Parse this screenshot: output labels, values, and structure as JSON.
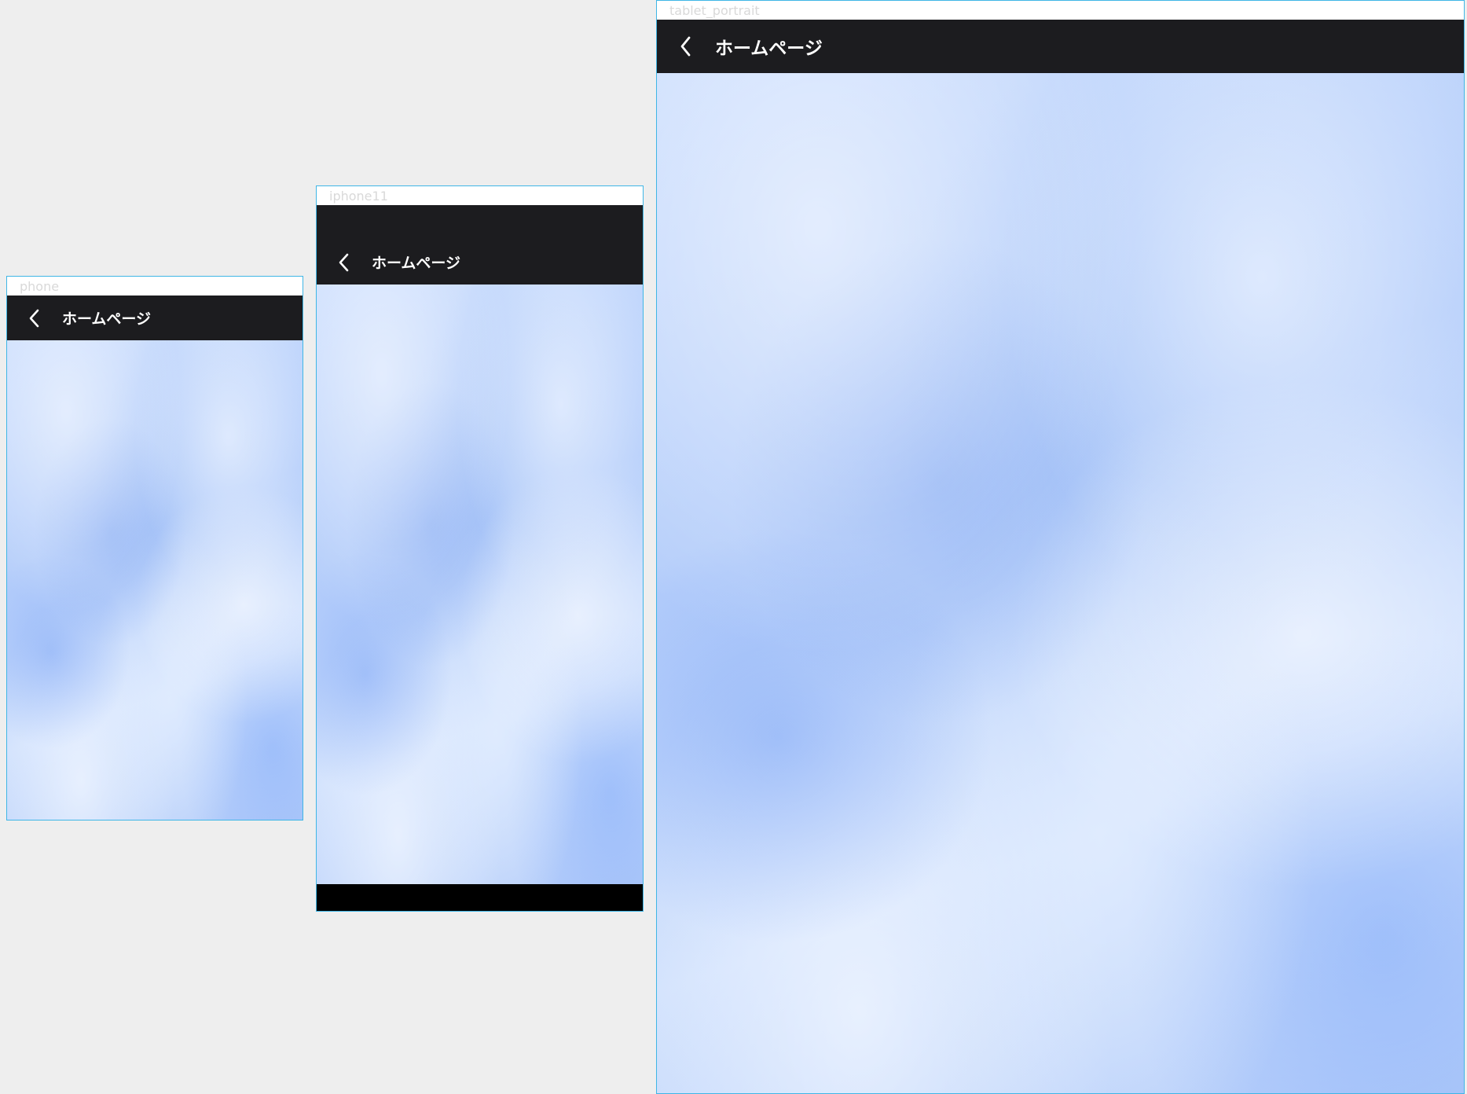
{
  "frames": {
    "phone": {
      "label": "phone",
      "appbar": {
        "back_icon": "chevron-left-icon",
        "title": "ホームページ"
      }
    },
    "iphone11": {
      "label": "iphone11",
      "appbar": {
        "back_icon": "chevron-left-icon",
        "title": "ホームページ"
      }
    },
    "tablet": {
      "label": "tablet_portrait",
      "appbar": {
        "back_icon": "chevron-left-icon",
        "title": "ホームページ"
      }
    }
  },
  "colors": {
    "canvas": "#eeeeee",
    "frame_border": "#3fb6e6",
    "appbar": "#1c1c1f",
    "appbar_text": "#ffffff",
    "content_blue": "#bcd3fb",
    "bottom_bar": "#000000"
  }
}
